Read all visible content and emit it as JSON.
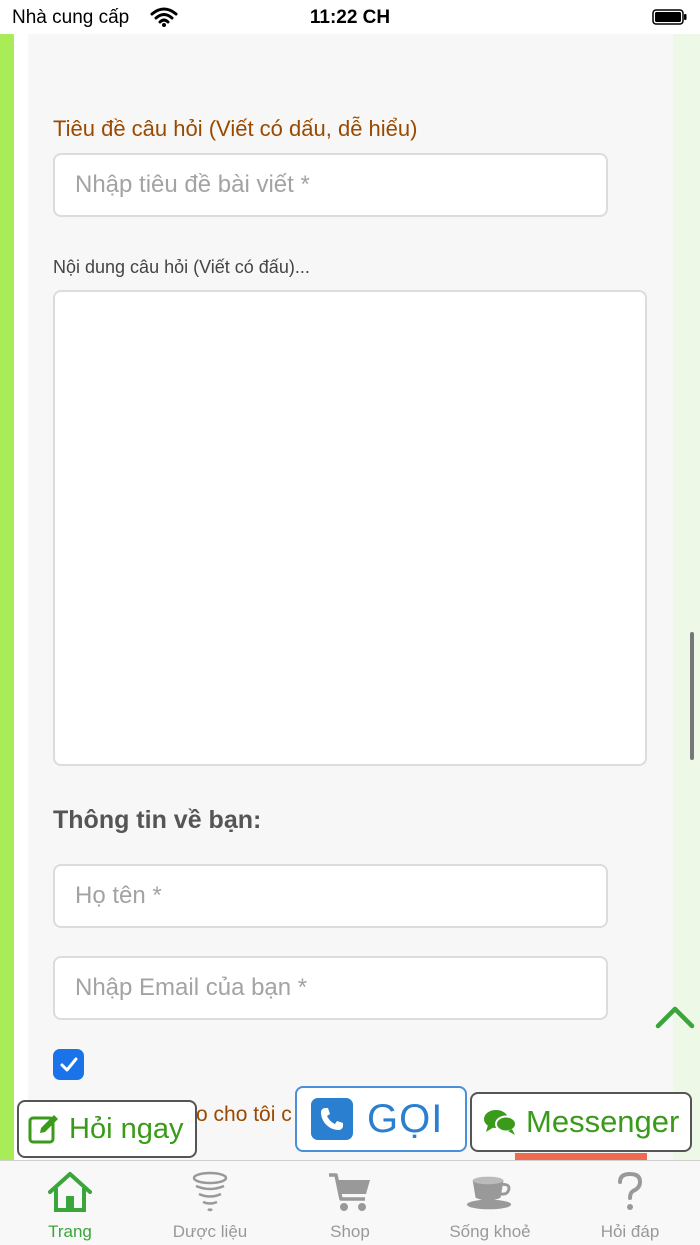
{
  "status_bar": {
    "carrier": "Nhà cung cấp",
    "time": "11:22 CH"
  },
  "form": {
    "title_label": "Tiêu đề câu hỏi (Viết có dấu, dễ hiểu)",
    "title_placeholder": "Nhập tiêu đề bài viết *",
    "content_label": "Nội dung câu hỏi (Viết có đấu)...",
    "content_value": "",
    "about_heading": "Thông tin về bạn:",
    "name_placeholder": "Họ tên *",
    "email_placeholder": "Nhập Email của bạn *",
    "agree_checked": true,
    "agree_text_partial": "o cho tôi c"
  },
  "floating": {
    "ask_label": "Hỏi ngay",
    "call_label": "GỌI",
    "messenger_label": "Messenger"
  },
  "tabs": [
    {
      "label": "Trang",
      "icon": "home-icon",
      "active": true
    },
    {
      "label": "Dược liệu",
      "icon": "herb-icon",
      "active": false
    },
    {
      "label": "Shop",
      "icon": "cart-icon",
      "active": false
    },
    {
      "label": "Sống khoẻ",
      "icon": "cup-icon",
      "active": false
    },
    {
      "label": "Hỏi đáp",
      "icon": "question-icon",
      "active": false
    }
  ],
  "colors": {
    "accent_green": "#3aa53a",
    "label_brown": "#9a4a00",
    "call_blue": "#2a7fd0",
    "stripe_green": "#a8ec57"
  }
}
